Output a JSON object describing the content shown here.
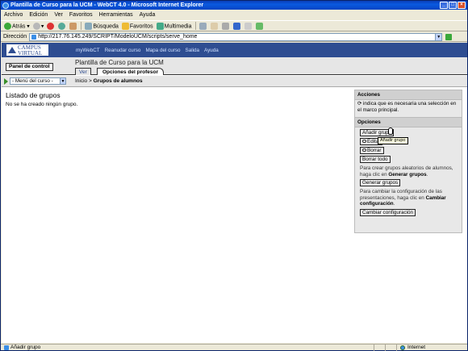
{
  "window": {
    "title": "Plantilla de Curso para la UCM - WebCT 4.0 - Microsoft Internet Explorer"
  },
  "menubar": [
    "Archivo",
    "Edición",
    "Ver",
    "Favoritos",
    "Herramientas",
    "Ayuda"
  ],
  "toolbar": {
    "back": "Atrás",
    "search": "Búsqueda",
    "favorites": "Favoritos",
    "media": "Multimedia"
  },
  "address": {
    "label": "Dirección",
    "url": "http://217.76.145.249/SCRIPT/ModeloUCM/scripts/serve_home",
    "go": "Ir",
    "links": "Vínculos"
  },
  "header": {
    "logo_line1": "CAMPUS",
    "logo_line2": "VIRTUAL",
    "nav": [
      "myWebCT",
      "Reanudar curso",
      "Mapa del curso",
      "Salida",
      "Ayuda"
    ],
    "panel_button": "Panel de control",
    "course_title": "Plantilla de Curso para la UCM",
    "tabs": [
      "Ver",
      "Opciones del profesor"
    ],
    "course_menu": "- Menú del curso -",
    "breadcrumb_home": "Inicio",
    "breadcrumb_sep": ">",
    "breadcrumb_current": "Grupos de alumnos"
  },
  "main": {
    "heading": "Listado de grupos",
    "message": "No se ha creado ningún grupo."
  },
  "side": {
    "acciones_title": "Acciones",
    "acciones_text": "indica que es necesaria una selección en el marco principal.",
    "opciones_title": "Opciones",
    "add_group": "Añadir grupo",
    "edit": "Editar",
    "delete": "Borrar",
    "delete_all": "Borrar todo",
    "gen_text_a": "Para crear grupos aleatorios de alumnos, haga clic en ",
    "gen_text_b": "Generar grupos",
    "gen_text_c": ".",
    "generate": "Generar grupos",
    "conf_text_a": "Para cambiar la configuración de las presentaciones, haga clic en ",
    "conf_text_b": "Cambiar configuración",
    "conf_text_c": ".",
    "change_config": "Cambiar configuración",
    "tooltip": "Añadir grupo"
  },
  "status": {
    "left": "Añadir grupo",
    "zone": "Internet"
  }
}
